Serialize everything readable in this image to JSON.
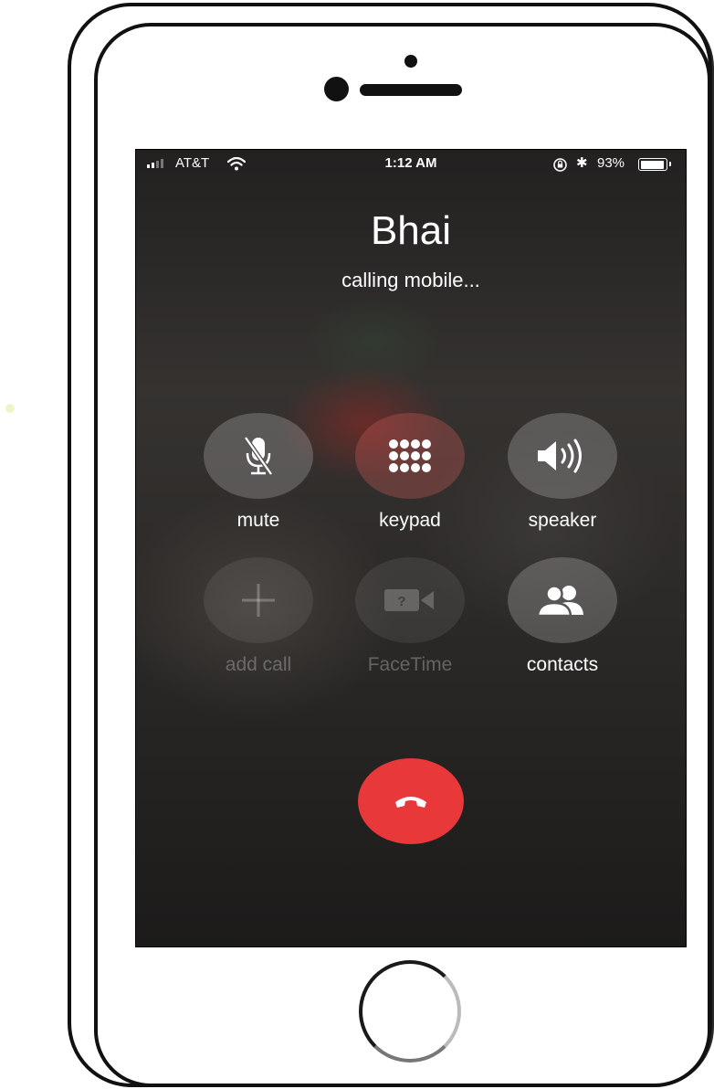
{
  "status_bar": {
    "carrier": "AT&T",
    "time": "1:12 AM",
    "battery_percent": "93%",
    "signal_bars": 2,
    "signal_bars_total": 4,
    "battery_level": 0.93,
    "icons": [
      "signal-icon",
      "wifi-icon",
      "rotation-lock-icon",
      "bluetooth-icon",
      "battery-icon"
    ]
  },
  "call": {
    "caller_name": "Bhai",
    "status": "calling mobile..."
  },
  "controls": {
    "mute": {
      "label": "mute",
      "icon": "mic-off-icon",
      "enabled": true
    },
    "keypad": {
      "label": "keypad",
      "icon": "keypad-icon",
      "enabled": true
    },
    "speaker": {
      "label": "speaker",
      "icon": "speaker-icon",
      "enabled": true
    },
    "add_call": {
      "label": "add call",
      "icon": "plus-icon",
      "enabled": false
    },
    "facetime": {
      "label": "FaceTime",
      "icon": "video-camera-icon",
      "enabled": false
    },
    "contacts": {
      "label": "contacts",
      "icon": "contacts-icon",
      "enabled": true
    }
  },
  "end_call": {
    "icon": "hang-up-icon",
    "color": "#e8383a"
  }
}
